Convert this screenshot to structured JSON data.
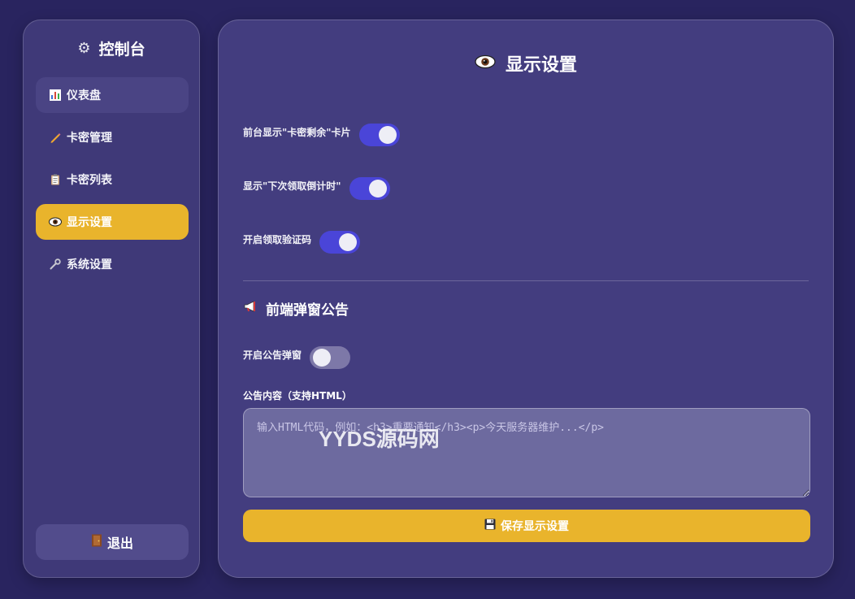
{
  "sidebar": {
    "brand": "控制台",
    "items": [
      {
        "label": "仪表盘"
      },
      {
        "label": "卡密管理"
      },
      {
        "label": "卡密列表"
      },
      {
        "label": "显示设置"
      },
      {
        "label": "系统设置"
      }
    ],
    "logout": "退出"
  },
  "main": {
    "title": "显示设置",
    "settings": [
      {
        "label": "前台显示\"卡密剩余\"卡片",
        "enabled": true
      },
      {
        "label": "显示\"下次领取倒计时\"",
        "enabled": true
      },
      {
        "label": "开启领取验证码",
        "enabled": true
      }
    ],
    "announce": {
      "section_title": "前端弹窗公告",
      "toggle_label": "开启公告弹窗",
      "toggle_enabled": false,
      "content_label": "公告内容（支持HTML）",
      "placeholder": "输入HTML代码，例如：<h3>重要通知</h3><p>今天服务器维护...</p>"
    },
    "save_label": "保存显示设置"
  },
  "watermark": "YYDS源码网",
  "colors": {
    "background": "#29245f",
    "accent": "#e9b42c",
    "toggle_on": "#4a45d8"
  }
}
